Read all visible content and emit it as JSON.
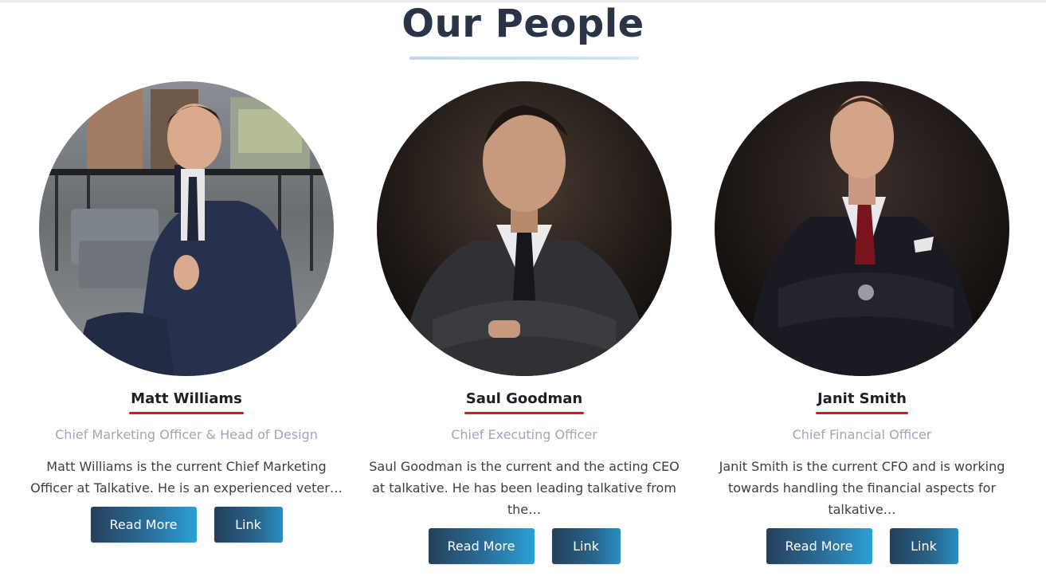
{
  "section": {
    "title": "Our People"
  },
  "people": [
    {
      "name": "Matt Williams",
      "role": "Chief Marketing Officer & Head of Design",
      "bio": "Matt Williams is the current Chief Marketing Officer  at Talkative. He is an experienced veter…",
      "read_more_label": "Read More",
      "link_label": "Link"
    },
    {
      "name": "Saul Goodman",
      "role": "Chief Executing Officer",
      "bio": "Saul Goodman is the current and the acting CEO at talkative. He has been leading talkative from the…",
      "read_more_label": "Read More",
      "link_label": "Link"
    },
    {
      "name": "Janit Smith",
      "role": "Chief Financial Officer",
      "bio": "Janit Smith is the current CFO and is working towards handling the financial aspects for talkative…",
      "read_more_label": "Read More",
      "link_label": "Link"
    }
  ],
  "colors": {
    "title": "#2b3446",
    "name_underline": "#e0141c",
    "role_text": "#9aa8ba",
    "button_gradient_start": "#26405a",
    "button_gradient_end": "#2aa1d6"
  }
}
